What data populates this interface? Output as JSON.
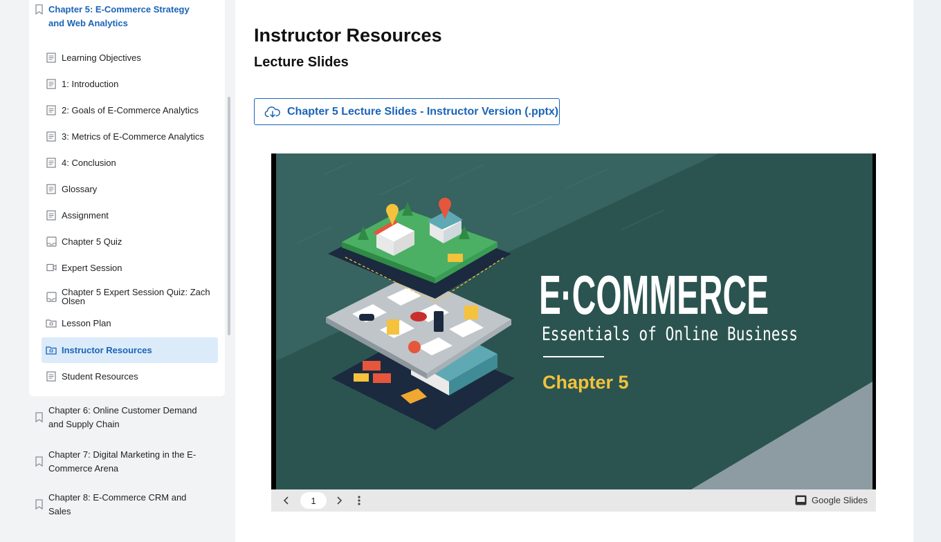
{
  "sidebar": {
    "chapters": [
      {
        "label": "Chapter 5: E-Commerce Strategy and Web Analytics",
        "active": true
      },
      {
        "label": "Chapter 6: Online Customer Demand and Supply Chain"
      },
      {
        "label": "Chapter 7: Digital Marketing in the E-Commerce Arena"
      },
      {
        "label": "Chapter 8: E-Commerce CRM and Sales"
      }
    ],
    "lessons": [
      {
        "label": "Learning Objectives",
        "icon": "document-icon"
      },
      {
        "label": "1: Introduction",
        "icon": "document-icon"
      },
      {
        "label": "2: Goals of E-Commerce Analytics",
        "icon": "document-icon"
      },
      {
        "label": "3: Metrics of E-Commerce Analytics",
        "icon": "document-icon"
      },
      {
        "label": "4: Conclusion",
        "icon": "document-icon"
      },
      {
        "label": "Glossary",
        "icon": "document-icon"
      },
      {
        "label": "Assignment",
        "icon": "document-icon"
      },
      {
        "label": "Chapter 5 Quiz",
        "icon": "quiz-icon"
      },
      {
        "label": "Expert Session",
        "icon": "video-icon"
      },
      {
        "label": "Chapter 5 Expert Session Quiz: Zach Olsen",
        "icon": "quiz-icon"
      },
      {
        "label": "Lesson Plan",
        "icon": "folder-icon"
      },
      {
        "label": "Instructor Resources",
        "icon": "folder-icon",
        "active": true
      },
      {
        "label": "Student Resources",
        "icon": "document-icon"
      }
    ]
  },
  "main": {
    "title": "Instructor Resources",
    "subtitle": "Lecture Slides",
    "download_label": "Chapter 5 Lecture Slides - Instructor Version (.pptx)"
  },
  "slide": {
    "title": "E·COMMERCE",
    "subtitle": "Essentials of Online Business",
    "chapter": "Chapter 5",
    "colors": {
      "bg": "#2b5450",
      "accent": "#f4c23c",
      "text": "#ffffff"
    }
  },
  "viewer": {
    "page": "1",
    "brand": "Google Slides"
  }
}
